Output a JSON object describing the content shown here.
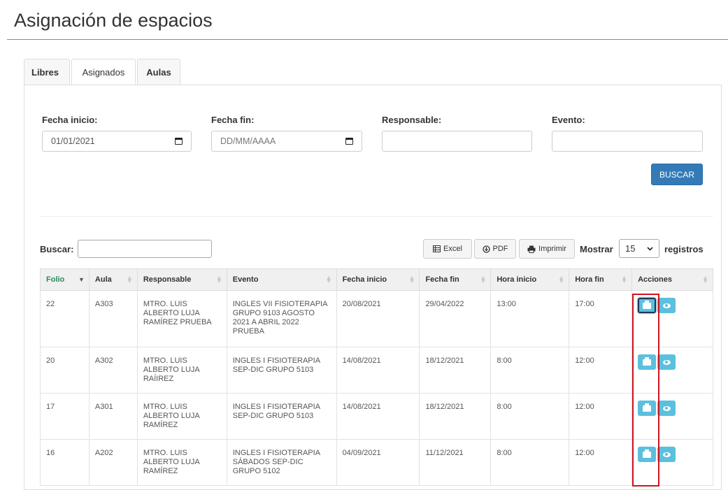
{
  "page": {
    "title": "Asignación de espacios"
  },
  "tabs": [
    {
      "label": "Libres"
    },
    {
      "label": "Asignados"
    },
    {
      "label": "Aulas"
    }
  ],
  "filters": {
    "fecha_inicio": {
      "label": "Fecha inicio:",
      "value": "01/01/2021"
    },
    "fecha_fin": {
      "label": "Fecha fin:",
      "placeholder": "DD/MM/AAAA"
    },
    "responsable": {
      "label": "Responsable:",
      "value": ""
    },
    "evento": {
      "label": "Evento:",
      "value": ""
    },
    "buscar_button": "BUSCAR"
  },
  "toolbar": {
    "search_label": "Buscar:",
    "search_value": "",
    "excel": "Excel",
    "pdf": "PDF",
    "imprimir": "Imprimir",
    "mostrar_label": "Mostrar",
    "mostrar_value": "15",
    "registros_label": "registros"
  },
  "table": {
    "columns": [
      "Folio",
      "Aula",
      "Responsable",
      "Evento",
      "Fecha inicio",
      "Fecha fin",
      "Hora inicio",
      "Hora fin",
      "Acciones"
    ],
    "rows": [
      {
        "folio": "22",
        "aula": "A303",
        "responsable": "MTRO. LUIS ALBERTO LUJA RAMÍREZ PRUEBA",
        "evento": "INGLES VII FISIOTERAPIA GRUPO 9103 AGOSTO 2021 A ABRIL 2022 PRUEBA",
        "fecha_inicio": "20/08/2021",
        "fecha_fin": "29/04/2022",
        "hora_inicio": "13:00",
        "hora_fin": "17:00"
      },
      {
        "folio": "20",
        "aula": "A302",
        "responsable": "MTRO. LUIS ALBERTO LUJA RAÍIREZ",
        "evento": "INGLES I FISIOTERAPIA SEP-DIC GRUPO 5103",
        "fecha_inicio": "14/08/2021",
        "fecha_fin": "18/12/2021",
        "hora_inicio": "8:00",
        "hora_fin": "12:00"
      },
      {
        "folio": "17",
        "aula": "A301",
        "responsable": "MTRO. LUIS ALBERTO LUJA RAMÍREZ",
        "evento": "INGLES I FISIOTERAPIA SEP-DIC GRUPO 5103",
        "fecha_inicio": "14/08/2021",
        "fecha_fin": "18/12/2021",
        "hora_inicio": "8:00",
        "hora_fin": "12:00"
      },
      {
        "folio": "16",
        "aula": "A202",
        "responsable": "MTRO. LUIS ALBERTO LUJA RAMÍREZ",
        "evento": "INGLES I FISIOTERAPIA SÁBADOS SEP-DIC GRUPO 5102",
        "fecha_inicio": "04/09/2021",
        "fecha_fin": "11/12/2021",
        "hora_inicio": "8:00",
        "hora_fin": "12:00"
      }
    ]
  },
  "colors": {
    "primary": "#337ab7",
    "info": "#5bc0de",
    "highlight": "#d0141f",
    "sorted_header": "#2e8b57"
  },
  "icons": {
    "calendar": "calendar-icon",
    "printer": "printer-icon",
    "eye": "eye-icon",
    "excel": "spreadsheet-icon",
    "pdf": "download-icon"
  }
}
